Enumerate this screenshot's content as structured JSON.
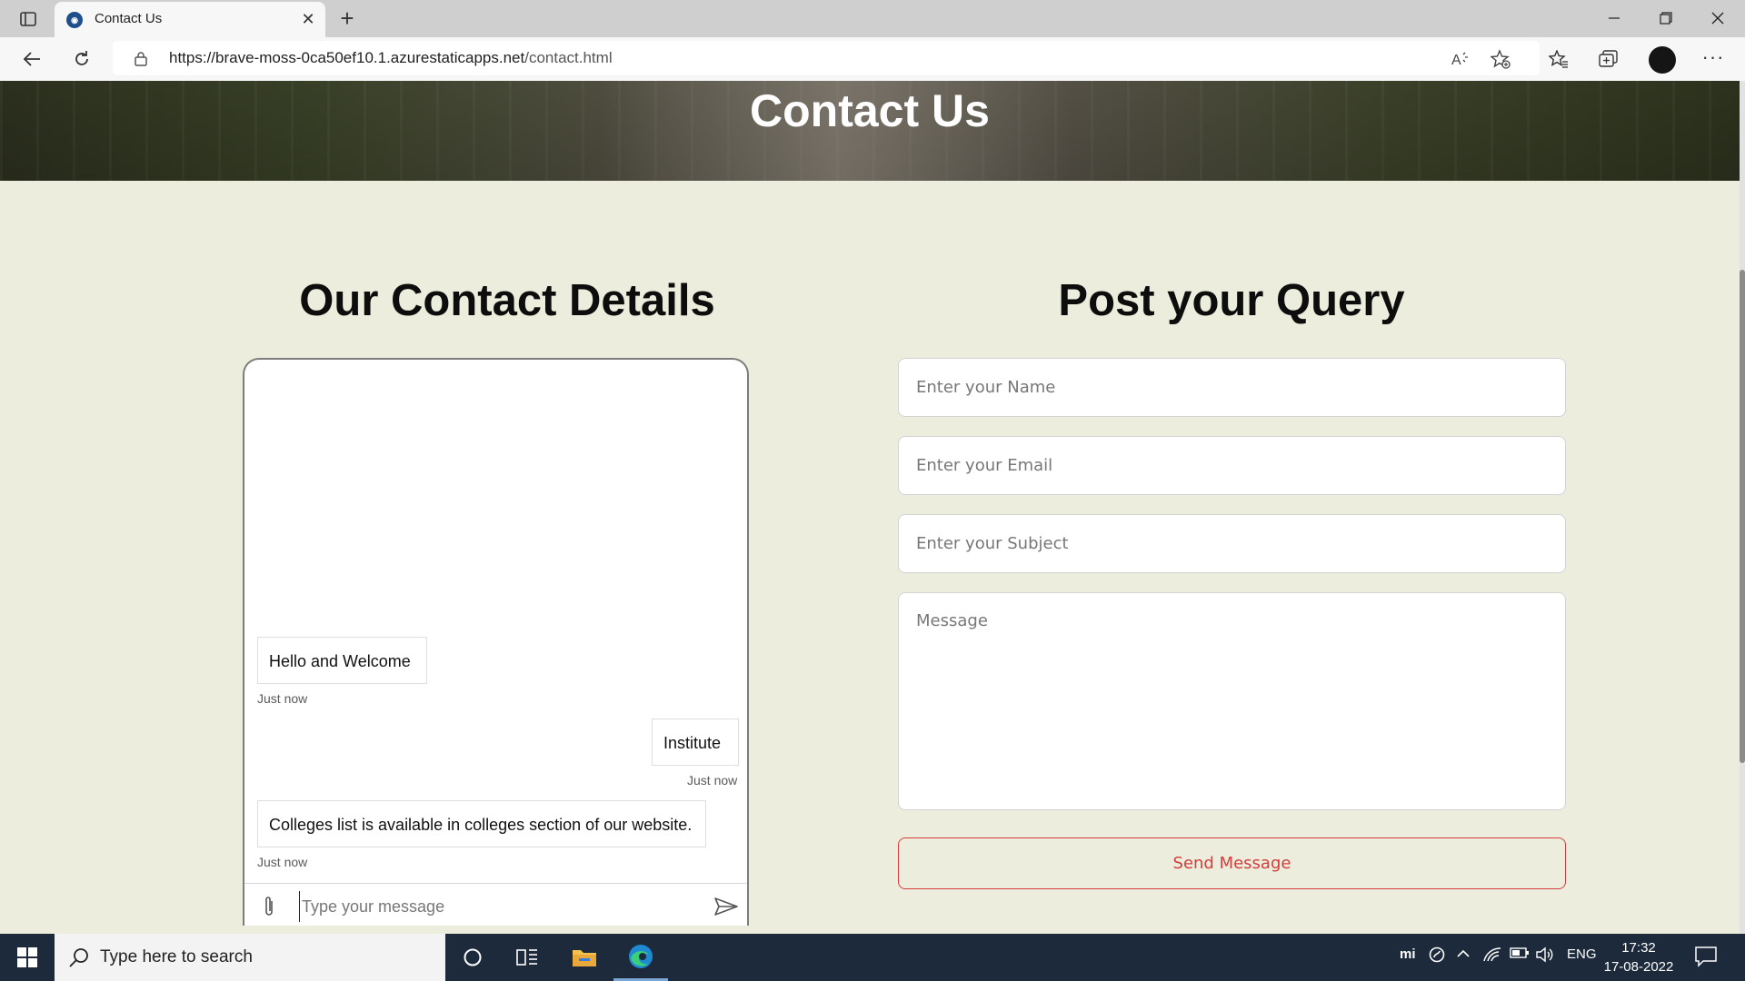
{
  "browser": {
    "tab_title": "Contact Us",
    "url_host": "https://brave-moss-0ca50ef10.1.azurestaticapps.net",
    "url_path": "/contact.html"
  },
  "hero": {
    "title": "Contact Us"
  },
  "contact": {
    "title": "Our Contact Details",
    "messages": [
      {
        "text": "Hello and Welcome",
        "time": "Just now",
        "side": "bot"
      },
      {
        "text": "Institute",
        "time": "Just now",
        "side": "user"
      },
      {
        "text": "Colleges list is available in colleges section of our website.",
        "time": "Just now",
        "side": "bot"
      }
    ],
    "input_placeholder": "Type your message"
  },
  "query": {
    "title": "Post your Query",
    "name_placeholder": "Enter your Name",
    "email_placeholder": "Enter your Email",
    "subject_placeholder": "Enter your Subject",
    "message_placeholder": "Message",
    "send_label": "Send Message"
  },
  "taskbar": {
    "search_placeholder": "Type here to search",
    "language": "ENG",
    "time": "17:32",
    "date": "17-08-2022"
  },
  "colors": {
    "accent_red": "#d43d3d",
    "page_bg": "#eceddc",
    "taskbar_bg": "#1c2a3c"
  }
}
